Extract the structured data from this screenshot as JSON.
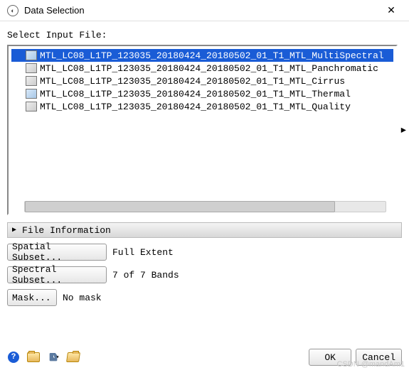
{
  "window": {
    "title": "Data Selection"
  },
  "labels": {
    "select_input_file": "Select Input File:",
    "file_information": "File Information"
  },
  "files": [
    {
      "name": "MTL_LC08_L1TP_123035_20180424_20180502_01_T1_MTL_MultiSpectral",
      "icon": "color",
      "selected": true
    },
    {
      "name": "MTL_LC08_L1TP_123035_20180424_20180502_01_T1_MTL_Panchromatic",
      "icon": "gray",
      "selected": false
    },
    {
      "name": "MTL_LC08_L1TP_123035_20180424_20180502_01_T1_MTL_Cirrus",
      "icon": "gray",
      "selected": false
    },
    {
      "name": "MTL_LC08_L1TP_123035_20180424_20180502_01_T1_MTL_Thermal",
      "icon": "color",
      "selected": false
    },
    {
      "name": "MTL_LC08_L1TP_123035_20180424_20180502_01_T1_MTL_Quality",
      "icon": "gray",
      "selected": false
    }
  ],
  "subset": {
    "spatial_btn": "Spatial Subset...",
    "spatial_val": "Full Extent",
    "spectral_btn": "Spectral Subset...",
    "spectral_val": "7 of 7 Bands",
    "mask_btn": "Mask...",
    "mask_val": "No mask"
  },
  "buttons": {
    "ok": "OK",
    "cancel": "Cancel"
  },
  "watermark": "CSDN @mandAm1"
}
